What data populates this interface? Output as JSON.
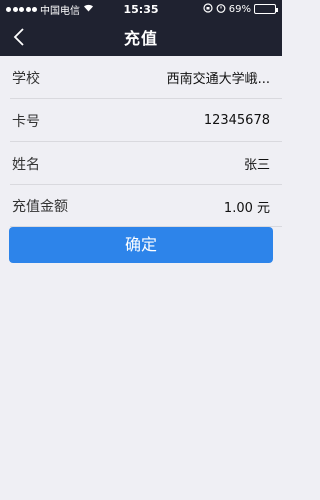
{
  "status_bar": {
    "carrier": "中国电信",
    "time": "15:35",
    "battery": "69%",
    "battery_level": 0.69
  },
  "nav": {
    "title": "充值"
  },
  "form": {
    "rows": [
      {
        "label": "学校",
        "value": "西南交通大学峨..."
      },
      {
        "label": "卡号",
        "value": "12345678"
      },
      {
        "label": "姓名",
        "value": "张三"
      },
      {
        "label": "充值金额",
        "value": "1.00 元"
      }
    ]
  },
  "actions": {
    "confirm_label": "确定"
  },
  "colors": {
    "topbar": "#1f2230",
    "background": "#efeff4",
    "button": "#2d84ea"
  }
}
